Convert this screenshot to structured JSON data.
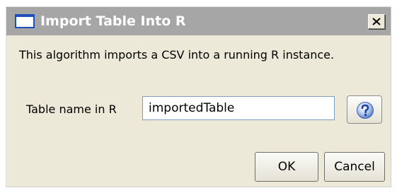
{
  "window": {
    "title": "Import Table Into R",
    "close_label": "×"
  },
  "dialog": {
    "description": "This algorithm imports a CSV into a running R instance.",
    "field_label": "Table name in R",
    "field_value": "importedTable"
  },
  "buttons": {
    "ok_label": "OK",
    "cancel_label": "Cancel"
  },
  "icons": {
    "app": "window-icon",
    "close": "close-icon",
    "help": "help-icon"
  },
  "colors": {
    "titlebar": "#a6a6a6",
    "dialog_bg": "#ece9d8",
    "help_blue": "#2a5cc7"
  }
}
